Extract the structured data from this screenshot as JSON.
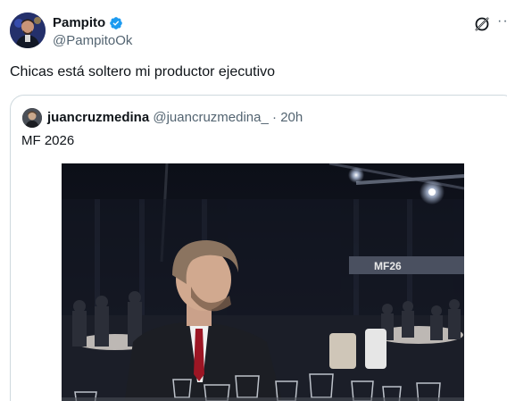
{
  "tweet": {
    "display_name": "Pampito",
    "handle": "@PampitoOk",
    "text": "Chicas está soltero mi productor ejecutivo",
    "icons": {
      "verified": "verified-badge-icon",
      "grok": "grok-icon",
      "more": "more-options-icon"
    },
    "more_label": "···"
  },
  "quote": {
    "display_name": "juancruzmedina",
    "handle": "@juancruzmedina_",
    "separator": "·",
    "time": "20h",
    "text": "MF 2026",
    "banner_text": "MF26"
  },
  "colors": {
    "verified": "#1d9bf0",
    "text": "#0f1419",
    "secondary": "#536471",
    "border": "#cfd9de"
  }
}
